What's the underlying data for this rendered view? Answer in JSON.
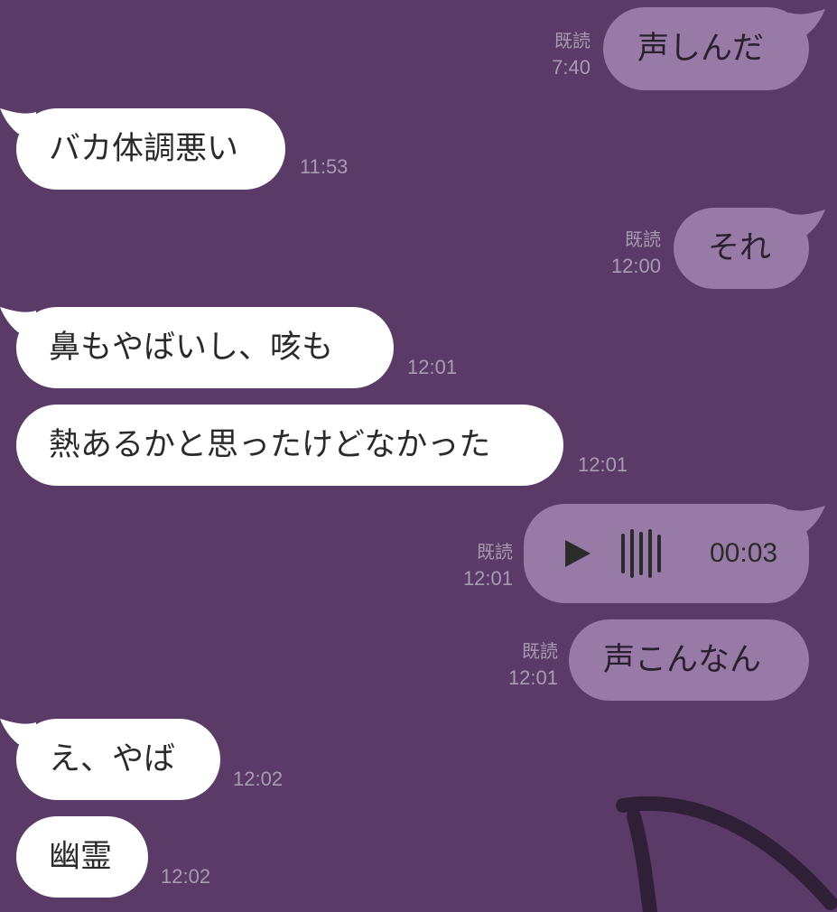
{
  "chat": {
    "messages": [
      {
        "side": "out",
        "text": "声しんだ",
        "read": "既読",
        "time": "7:40"
      },
      {
        "side": "in",
        "text": "バカ体調悪い",
        "time": "11:53"
      },
      {
        "side": "out",
        "text": "それ",
        "read": "既読",
        "time": "12:00"
      },
      {
        "side": "in",
        "text": "鼻もやばいし、咳も",
        "time": "12:01"
      },
      {
        "side": "in",
        "text": "熱あるかと思ったけどなかった",
        "time": "12:01"
      },
      {
        "side": "out",
        "type": "voice",
        "duration": "00:03",
        "read": "既読",
        "time": "12:01"
      },
      {
        "side": "out",
        "text": "声こんなん",
        "read": "既読",
        "time": "12:01"
      },
      {
        "side": "in",
        "text": "え、やば",
        "time": "12:02"
      },
      {
        "side": "in",
        "text": "幽霊",
        "time": "12:02"
      }
    ]
  },
  "icons": {
    "play": "play-icon",
    "waveform": "waveform-icon"
  },
  "colors": {
    "background": "#5a3b67",
    "incoming_bubble": "#ffffff",
    "outgoing_bubble": "#987aa6",
    "meta_text": "#a99ab3"
  }
}
